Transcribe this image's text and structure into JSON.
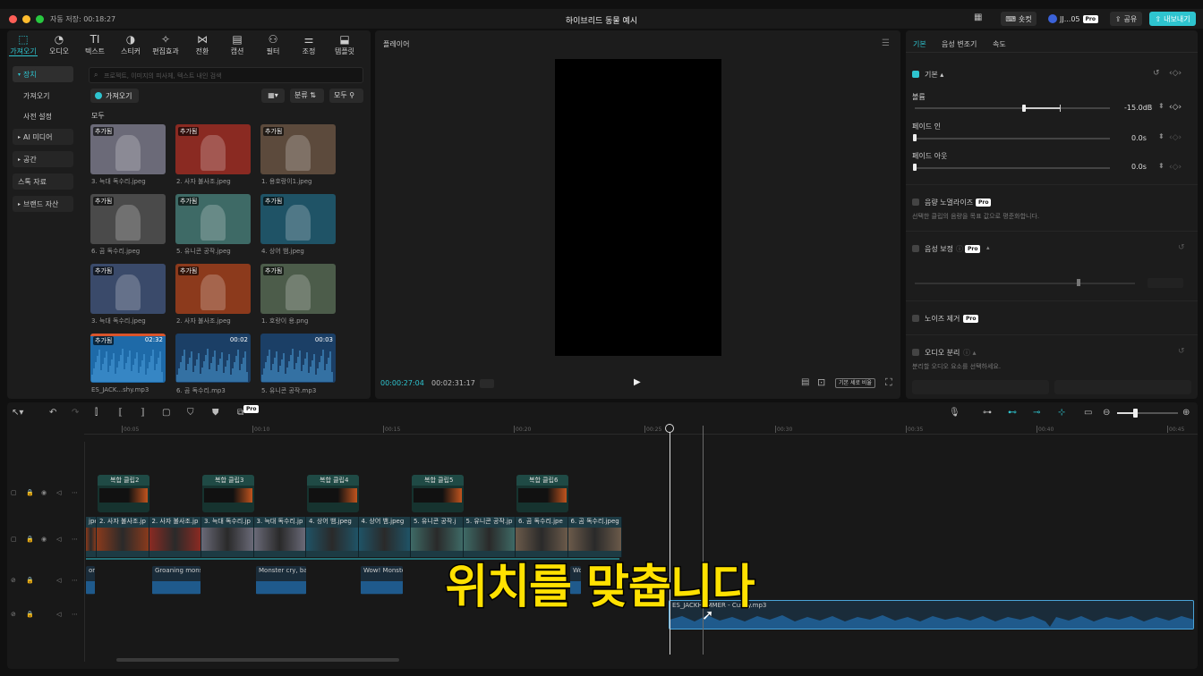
{
  "window": {
    "autosave": "자동 저장: 00:18:27",
    "title": "하이브리드 동물 예시",
    "shortcut_label": "숏컷",
    "user_label": "JJ...05",
    "pro_badge": "Pro",
    "share_label": "공유",
    "export_label": "내보내기"
  },
  "toolbar": {
    "items": [
      {
        "label": "가져오기",
        "icon": "import-icon"
      },
      {
        "label": "오디오",
        "icon": "audio-icon"
      },
      {
        "label": "텍스트",
        "icon": "text-icon"
      },
      {
        "label": "스티커",
        "icon": "sticker-icon"
      },
      {
        "label": "편집효과",
        "icon": "effects-icon"
      },
      {
        "label": "전환",
        "icon": "transition-icon"
      },
      {
        "label": "캡션",
        "icon": "caption-icon"
      },
      {
        "label": "필터",
        "icon": "filter-icon"
      },
      {
        "label": "조정",
        "icon": "adjust-icon"
      },
      {
        "label": "템플릿",
        "icon": "template-icon"
      }
    ]
  },
  "sidebar": {
    "items": [
      {
        "label": "장치"
      },
      {
        "label": "가져오기"
      },
      {
        "label": "사전 설정"
      },
      {
        "label": "AI 미디어"
      },
      {
        "label": "공간"
      },
      {
        "label": "스톡 자료"
      },
      {
        "label": "브랜드 자산"
      }
    ]
  },
  "media": {
    "search_placeholder": "프로젝트, 이미지의 피사체, 텍스트 내인 검색",
    "import_button": "가져오기",
    "sort_label": "분류",
    "filter_label": "모두",
    "section_label": "모두",
    "added_badge": "추가됨",
    "items": [
      {
        "caption": "3. 늑대 독수리.jpeg",
        "color": "#6b6a78"
      },
      {
        "caption": "2. 사자 불사조.jpeg",
        "color": "#8a2a22"
      },
      {
        "caption": "1. 용호랑이1.jpeg",
        "color": "#5c4a3c"
      },
      {
        "caption": "6. 곰 독수리.jpeg",
        "color": "#4a4a4a"
      },
      {
        "caption": "5. 유니콘 공작.jpeg",
        "color": "#3e6a66"
      },
      {
        "caption": "4. 상어 뱀.jpeg",
        "color": "#1f5366"
      },
      {
        "caption": "3. 늑대 독수리.jpeg",
        "color": "#3a4a6a"
      },
      {
        "caption": "2. 사자 불사조.jpeg",
        "color": "#8c3a1c"
      },
      {
        "caption": "1. 호랑이 용.png",
        "color": "#4c5c4a"
      },
      {
        "caption": "ES_JACK...shy.mp3",
        "duration": "02:32",
        "color": "#1e6aa8"
      },
      {
        "caption": "6. 곰 독수리.mp3",
        "duration": "00:02",
        "color": "#1b3f66"
      },
      {
        "caption": "5. 유니콘 공작.mp3",
        "duration": "00:03",
        "color": "#1b3f66"
      }
    ]
  },
  "player": {
    "title": "플레이어",
    "current_time": "00:00:27:04",
    "total_time": "00:02:31:17",
    "ratio_label": "기본 세로 비율"
  },
  "props": {
    "tabs": [
      "기본",
      "음성 변조기",
      "속도"
    ],
    "basic_label": "기본",
    "volume_label": "볼륨",
    "volume_value": "-15.0dB",
    "volume_level": 0.5,
    "fadein_label": "페이드 인",
    "fadein_value": "0.0s",
    "fadeout_label": "페이드 아웃",
    "fadeout_value": "0.0s",
    "normalize_label": "음량 노멀라이즈",
    "normalize_desc": "선택한 클립의 음량을 목표 값으로 평준화합니다.",
    "enhance_label": "음성 보정",
    "noise_label": "노이즈 제거",
    "separate_label": "오디오 분리",
    "separate_desc": "분리할 오디오 요소를 선택하세요."
  },
  "timeline": {
    "ticks": [
      "00:05",
      "00:10",
      "00:15",
      "00:20",
      "00:25",
      "00:30",
      "00:35",
      "00:40",
      "00:45"
    ],
    "compound_clips": [
      "복합 클립2",
      "복합 클립3",
      "복합 클립4",
      "복합 클립5",
      "복합 클립6"
    ],
    "video_clips": [
      "jpeg",
      "2. 사자 불사조.jp",
      "2. 사자 불사조.jp",
      "3. 늑대 독수리.jp",
      "3. 늑대 독수리.jp",
      "4. 상어 뱀.jpeg",
      "4. 상어 뱀.jpeg",
      "5. 유니콘 공작.j",
      "5. 유니콘 공작.jp",
      "6. 곰 독수리.jpe",
      "6. 곰 독수리.jpeg"
    ],
    "audio_clips": [
      "onst",
      "Groaning mons",
      "Monster cry, ba",
      "Wow! Monste",
      "Wow"
    ],
    "music_clip": "ES_JACKHAMMER - Cushy.mp3"
  },
  "subtitle": "위치를 맞춥니다"
}
